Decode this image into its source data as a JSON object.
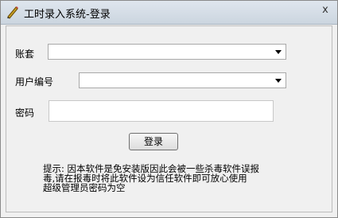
{
  "window": {
    "title": "工时录入系统-登录",
    "close_glyph": "x"
  },
  "form": {
    "account_label": "账套",
    "user_label": "用户编号",
    "password_label": "密码",
    "login_label": "登录"
  },
  "tip": {
    "line1": "提示: 因本软件是免安装版因此会被一些杀毒软件误报",
    "line2": "毒,请在报毒时将此软件设为信任软件即可放心使用",
    "line3": "超级管理员密码为空"
  }
}
